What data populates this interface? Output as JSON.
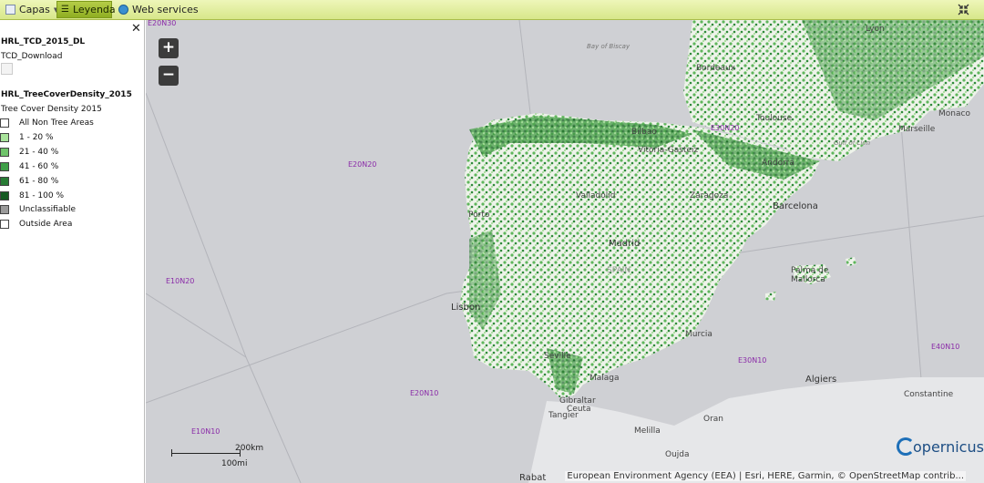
{
  "toolbar": {
    "tabs": [
      {
        "label": "Capas"
      },
      {
        "label": "Leyenda"
      },
      {
        "label": "Web services"
      }
    ]
  },
  "panel": {
    "layers": [
      {
        "title": "HRL_TCD_2015_DL",
        "subtitle": "TCD_Download"
      },
      {
        "title": "HRL_TreeCoverDensity_2015",
        "subtitle": "Tree Cover Density 2015"
      }
    ],
    "legend": [
      {
        "label": "All Non Tree Areas",
        "color": "#ffffff"
      },
      {
        "label": "1 - 20 %",
        "color": "#a9e39b"
      },
      {
        "label": "21 - 40 %",
        "color": "#6fc46a"
      },
      {
        "label": "41 - 60 %",
        "color": "#3f9f48"
      },
      {
        "label": "61 - 80 %",
        "color": "#287c35"
      },
      {
        "label": "81 - 100 %",
        "color": "#155a22"
      },
      {
        "label": "Unclassifiable",
        "color": "#9a9a9a"
      },
      {
        "label": "Outside Area",
        "color": "#ffffff"
      }
    ]
  },
  "map": {
    "grid_labels": [
      "E20N30",
      "E20N20",
      "E10N20",
      "E30N20",
      "E20N10",
      "E30N10",
      "E40N10",
      "E10N10"
    ],
    "places": [
      "Bay of Biscay",
      "Bordeaux",
      "Toulouse",
      "Monaco",
      "Marseille",
      "Gulf of Lion",
      "Lyon",
      "Andorra",
      "Bilbao",
      "Vitoria-Gasteiz",
      "Valladolid",
      "Zaragoza",
      "Barcelona",
      "Porto",
      "Madrid",
      "SPAIN",
      "Lisbon",
      "Palma de Mallorca",
      "Murcia",
      "Seville",
      "Malaga",
      "Gibraltar",
      "Ceuta",
      "Tangier",
      "Algiers",
      "Constantine",
      "Oran",
      "Melilla",
      "Oujda",
      "Rabat"
    ],
    "scale": {
      "km": "200km",
      "mi": "100mi"
    },
    "attribution": "European Environment Agency (EEA) | Esri, HERE, Garmin, © OpenStreetMap contrib...",
    "logo": "opernicus",
    "zoom_in": "+",
    "zoom_out": "−",
    "accent": "#8a2ba8"
  }
}
